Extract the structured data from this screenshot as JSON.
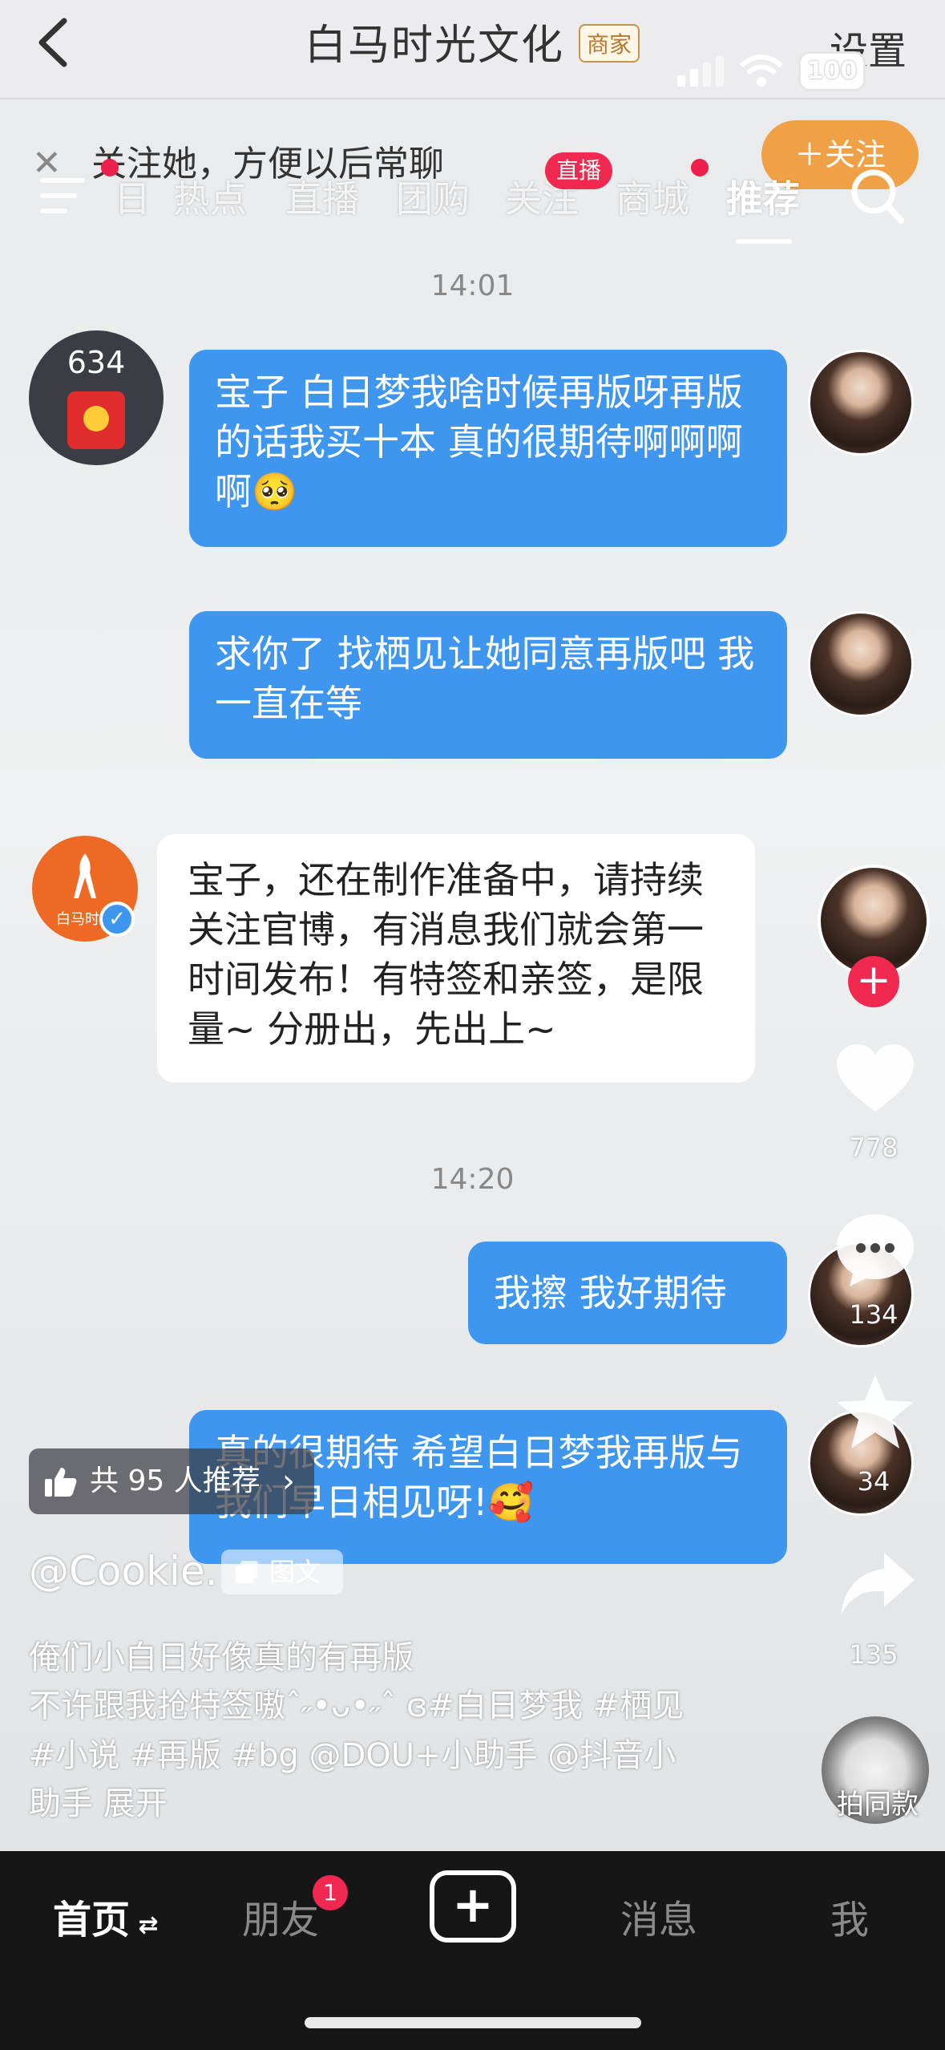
{
  "chat_header": {
    "title": "白马时光文化",
    "merchant_badge": "商家",
    "settings": "设置",
    "battery": "100"
  },
  "follow_hint": {
    "close": "✕",
    "text": "关注她，方便以后常聊",
    "button": "＋关注"
  },
  "top_nav": {
    "tabs": [
      "日",
      "热点",
      "直播",
      "团购",
      "关注",
      "商城",
      "推荐"
    ],
    "live_badge": "直播",
    "active_tab": "推荐"
  },
  "chat": {
    "time1": "14:01",
    "time2": "14:20",
    "red_packet_count": "634",
    "messages": [
      {
        "text": "宝子 白日梦我啥时候再版呀再版的话我买十本 真的很期待啊啊啊啊🥺"
      },
      {
        "text": "求你了 找栖见让她同意再版吧 我一直在等"
      },
      {
        "text": "宝子，还在制作准备中，请持续关注官博，有消息我们就会第一时间发布！有特签和亲签，是限量~ 分册出，先出上~"
      },
      {
        "text": "我擦 我好期待"
      },
      {
        "text": "真的很期待 希望白日梦我再版与我们早日相见呀!🥰"
      }
    ],
    "brand_avatar_text": "白马时光"
  },
  "side_actions": {
    "likes": "778",
    "comments": "134",
    "favorites": "34",
    "shares": "135",
    "same_style": "拍同款"
  },
  "post": {
    "recommend": "共 95 人推荐",
    "author": "@Cookie.",
    "type_tag": "图文",
    "desc_lines": [
      "俺们小白日好像真的有再版",
      "不许跟我抢特签嗷ˆ˶•ᴗ•˶ˆ ɞ#白日梦我 #栖见",
      "#小说 #再版 #bg @DOU+小助手 @抖音小",
      "助手  展开"
    ]
  },
  "tab_bar": {
    "home": "首页",
    "friends": "朋友",
    "friends_badge": "1",
    "create": "+",
    "messages": "消息",
    "me": "我"
  },
  "colors": {
    "bubble_blue": "#3f96ee",
    "accent_red": "#f1284f",
    "follow_orange": "#f19a33"
  }
}
